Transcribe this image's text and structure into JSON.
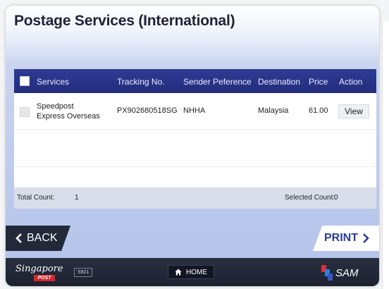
{
  "title": "Postage Services (International)",
  "table": {
    "columns": [
      "Services",
      "Tracking No.",
      "Sender Peference",
      "Destination",
      "Price",
      "Action"
    ],
    "rows": [
      {
        "service_line1": "Speedpost",
        "service_line2": "Express Overseas",
        "tracking_no": "PX902680518SG",
        "sender_reference": "NHHA",
        "destination": "Malaysia",
        "price": "61.00",
        "action": "View"
      }
    ],
    "footer": {
      "total_label": "Total Count:",
      "total_value": "1",
      "selected_label": "Selected Count:",
      "selected_value": "0"
    }
  },
  "nav": {
    "back_label": "BACK",
    "print_label": "PRINT"
  },
  "footer_bar": {
    "logo_script": "Singapore",
    "logo_post": "POST",
    "kiosk_id": "S921",
    "home_label": "HOME",
    "brand": "SAM"
  },
  "icons": {
    "back": "chevron-left-icon",
    "print": "chevron-right-icon",
    "home": "house-icon"
  },
  "colors": {
    "header_bar": "#2a3488",
    "accent_blue": "#2b3b9a",
    "footer_bar": "#1f2433",
    "post_red": "#d7262e"
  }
}
